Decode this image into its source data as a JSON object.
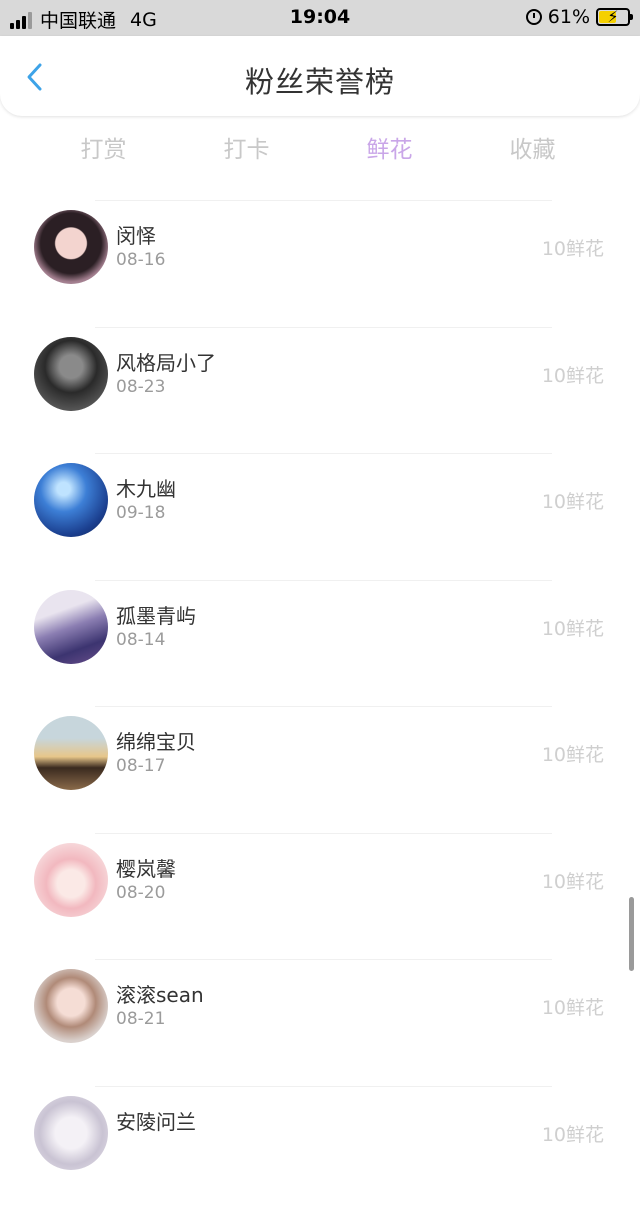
{
  "status_bar": {
    "carrier": "中国联通",
    "network": "4G",
    "time": "19:04",
    "battery_percent": "61%",
    "battery_level": 0.61,
    "icons": [
      "signal-icon",
      "alarm-icon",
      "battery-charging-icon"
    ]
  },
  "header": {
    "title": "粉丝荣誉榜",
    "back_icon": "chevron-left-icon"
  },
  "tabs": [
    {
      "label": "打赏"
    },
    {
      "label": "打卡"
    },
    {
      "label": "鲜花"
    },
    {
      "label": "收藏"
    }
  ],
  "active_tab": "鲜花",
  "colors": {
    "accent": "#c9a6e8",
    "back_icon": "#3da3e8",
    "inactive_tab": "#c8c8c8"
  },
  "fans": [
    {
      "name": "闵怿",
      "date": "08-16",
      "count": "10鲜花"
    },
    {
      "name": "风格局小了",
      "date": "08-23",
      "count": "10鲜花"
    },
    {
      "name": "木九幽",
      "date": "09-18",
      "count": "10鲜花"
    },
    {
      "name": "孤墨青屿",
      "date": "08-14",
      "count": "10鲜花"
    },
    {
      "name": "绵绵宝贝",
      "date": "08-17",
      "count": "10鲜花"
    },
    {
      "name": "樱岚馨",
      "date": "08-20",
      "count": "10鲜花"
    },
    {
      "name": "滚滚sean",
      "date": "08-21",
      "count": "10鲜花"
    },
    {
      "name": "安陵问兰",
      "date": "",
      "count": "10鲜花"
    }
  ]
}
